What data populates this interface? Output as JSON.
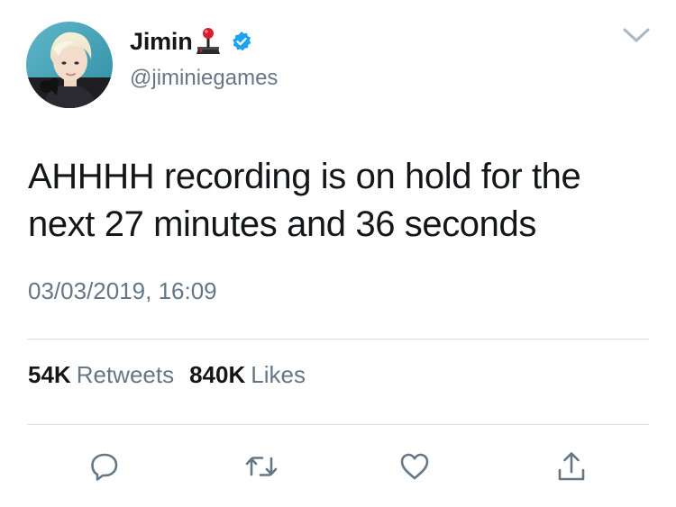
{
  "author": {
    "display_name": "Jimin",
    "handle": "@jiminiegames",
    "verified": true,
    "name_emoji": "joystick-icon"
  },
  "tweet": {
    "text": "AHHHH recording is on hold for the next 27 minutes and 36 seconds",
    "timestamp": "03/03/2019, 16:09"
  },
  "stats": {
    "retweets_count": "54K",
    "retweets_label": "Retweets",
    "likes_count": "840K",
    "likes_label": "Likes"
  },
  "actions": [
    "reply-icon",
    "retweet-icon",
    "like-icon",
    "share-icon"
  ],
  "colors": {
    "text": "#14171a",
    "secondary": "#657786",
    "verified_blue": "#1da1f2",
    "divider": "#d6dbdf"
  }
}
